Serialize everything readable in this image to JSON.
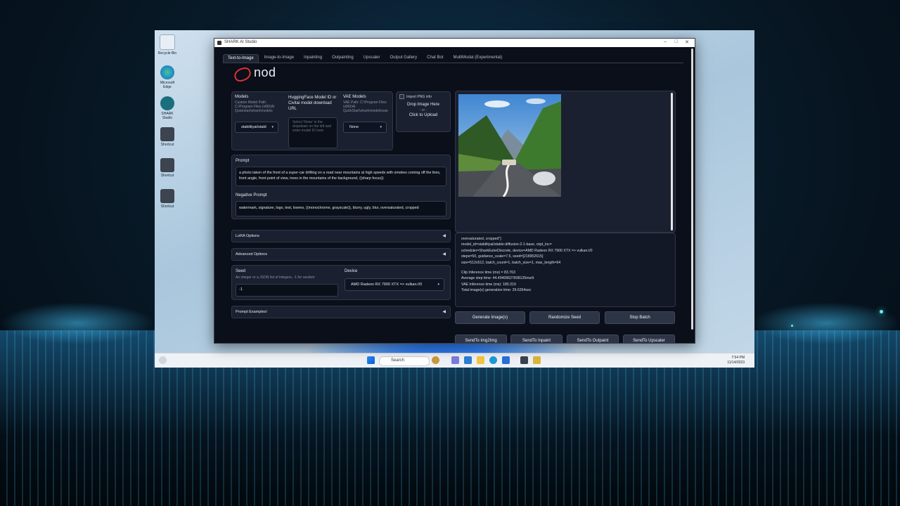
{
  "app": {
    "window_title": "SHARK AI Studio",
    "logo_text": "nod",
    "tabs": [
      "Text-to-Image",
      "Image-to-Image",
      "Inpainting",
      "Outpainting",
      "Upscaler",
      "Output Gallery",
      "Chat Bot",
      "MultiModal (Experimental)"
    ],
    "active_tab": "Text-to-Image"
  },
  "models": {
    "label": "Models",
    "path": "Custom Model Path: C:\\Program Files (x86)\\AI Quickstart\\shark\\models",
    "selected": "stabilityai/stabl"
  },
  "hf": {
    "label": "HuggingFace Model ID or Civitai model download URL",
    "placeholder": "Select 'None' in the dropdown on the left and enter model ID here"
  },
  "vae": {
    "label": "VAE Models",
    "path": "VAE Path: C:\\Program Files (x86)\\AI QuickStart\\shark\\models\\vae",
    "selected": "None"
  },
  "png_import": {
    "label": "Import PNG info",
    "drop_line1": "Drop Image Here",
    "drop_line2": "- or -",
    "drop_line3": "Click to Upload"
  },
  "prompt": {
    "label": "Prompt",
    "value": "a photo taken of the front of a super-car drifting on a road near mountains at high speeds with smokes coming off the tires, front angle, front point of view, trees in the mountains of the background, ((sharp focus))"
  },
  "negative_prompt": {
    "label": "Negative Prompt",
    "value": "watermark, signature, logo, text, lowres, ((monochrome, grayscale)), blurry, ugly, blur, oversaturated, cropped"
  },
  "accordions": {
    "lora": "LoRA Options",
    "advanced": "Advanced Options",
    "examples": "Prompt Examples!"
  },
  "seed": {
    "label": "Seed",
    "hint": "An integer or a JSON list of integers, -1 for random",
    "value": "-1"
  },
  "device": {
    "label": "Device",
    "selected": "AMD Radeon RX 7900 XTX => vulkan://0"
  },
  "output_log": [
    "oversaturated, cropped\"]",
    "model_id=stabilityai/stable-diffusion-2-1-base, ckpt_loc=",
    "scheduler=SharkEulerDiscrete, device=AMD Radeon RX 7900 XTX => vulkan://0",
    "steps=50, guidance_scale=7.5, seed=[218952615]",
    "size=512x512, batch_count=1, batch_size=1, max_length=64",
    "",
    "Clip Inference time (ms) = 83.763",
    "Average step time: 44.49409627838135ms/it",
    "VAE Inference time (ms): 180.319",
    "Total image(s) generation time: 29.6354sec"
  ],
  "buttons": {
    "generate": "Generate Image(s)",
    "randomize": "Randomize Seed",
    "stop": "Stop Batch",
    "send_img2img": "SendTo Img2Img",
    "send_inpaint": "SendTo Inpaint",
    "send_outpaint": "SendTo Outpaint",
    "send_upscaler": "SendTo Upscaler"
  },
  "taskbar": {
    "search": "Search",
    "time": "7:54 PM",
    "date": "11/14/2023"
  },
  "desktop_icons": [
    "Recycle Bin",
    "Microsoft Edge",
    "SHARK Studio",
    "Shortcut",
    "Shortcut",
    "Shortcut"
  ],
  "colors": {
    "app_bg": "#0b0f19",
    "panel_bg": "#1a2030",
    "logo_red": "#dd3333",
    "glow": "#66eeff"
  }
}
